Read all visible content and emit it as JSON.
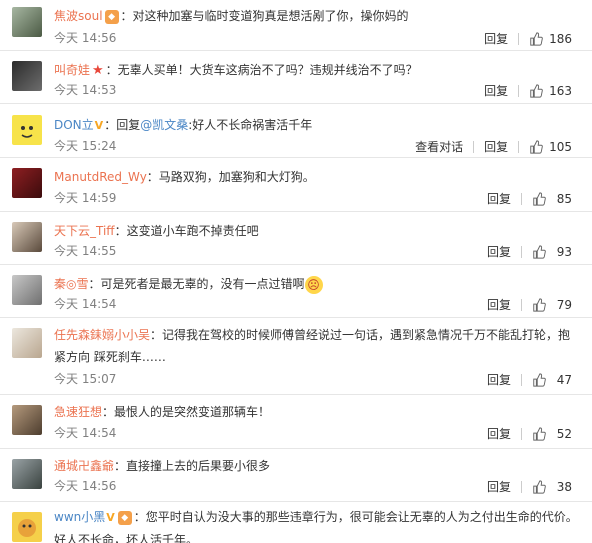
{
  "labels": {
    "reply": "回复",
    "conversation": "查看对话"
  },
  "comments": [
    {
      "user": "焦波soul",
      "text": "：对这种加塞与临时变道狗真是想活剐了你，操你妈的",
      "time": "今天 14:56",
      "likes": "186"
    },
    {
      "user": "叫奇娃",
      "text": "：无辜人买单！大货车这病治不了吗？违规并线治不了吗？",
      "time": "今天 14:53",
      "likes": "163"
    },
    {
      "user": "DON立",
      "reply_prefix": "：回复",
      "mention": "@凯文桑",
      "text": ":好人不长命祸害活千年",
      "time": "今天 15:24",
      "likes": "105"
    },
    {
      "user": "ManutdRed_Wy",
      "text": "：马路双狗，加塞狗和大灯狗。",
      "time": "今天 14:59",
      "likes": "85"
    },
    {
      "user": "天下云_Tiff",
      "text": "：这变道小车跑不掉责任吧",
      "time": "今天 14:55",
      "likes": "93"
    },
    {
      "user": "秦◎雪",
      "text": "：可是死者是最无辜的，没有一点过错啊",
      "time": "今天 14:54",
      "likes": "79"
    },
    {
      "user": "任先森銇嫋小小吴",
      "text": "：记得我在驾校的时候师傅曾经说过一句话，遇到紧急情况千万不能乱打轮，抱紧方向 踩死刹车……",
      "time": "今天 15:07",
      "likes": "47"
    },
    {
      "user": "急速狂想",
      "text": "：最恨人的是突然变道那辆车！",
      "time": "今天 14:54",
      "likes": "52"
    },
    {
      "user": "通城卍鑫爺",
      "text": "：直接撞上去的后果要小很多",
      "time": "今天 14:56",
      "likes": "38"
    },
    {
      "user": "wwn小黑",
      "text": "：您平时自认为没大事的那些违章行为，很可能会让无辜的人为之付出生命的代价。好人不长命，坏人活千年。",
      "time": "",
      "likes": ""
    }
  ]
}
